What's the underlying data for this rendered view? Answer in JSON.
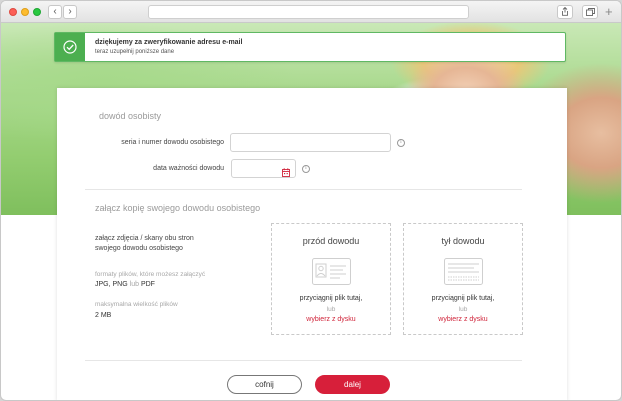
{
  "browser": {
    "back_glyph": "‹",
    "forward_glyph": "›",
    "share_icon": "share-icon",
    "tabs_icon": "tabs-icon",
    "plus_glyph": "+"
  },
  "banner": {
    "title": "dziękujemy za zweryfikowanie adresu e-mail",
    "subtitle": "teraz uzupełnij poniższe dane",
    "icon": "check-circle-icon",
    "accent_color": "#4caf50"
  },
  "id_section": {
    "title": "dowód osobisty",
    "fields": [
      {
        "label": "seria i numer dowodu osobistego",
        "value": ""
      },
      {
        "label": "data ważności dowodu",
        "value": ""
      }
    ],
    "info_glyph": "i"
  },
  "attach_section": {
    "title": "załącz kopię swojego dowodu osobistego",
    "instructions": [
      "załącz zdjęcia / skany obu stron",
      "swojego dowodu osobistego"
    ],
    "formats_label": "formaty plików, które możesz załączyć",
    "formats": {
      "a": "JPG, PNG",
      "or": "lub",
      "b": "PDF"
    },
    "max_size_label": "maksymalna wielkość plików",
    "max_size": "2 MB",
    "dropzones": [
      {
        "title": "przód dowodu",
        "text": "przyciągnij plik tutaj,",
        "or": "lub",
        "link": "wybierz z dysku",
        "icon": "id-card-front-icon"
      },
      {
        "title": "tył dowodu",
        "text": "przyciągnij plik tutaj,",
        "or": "lub",
        "link": "wybierz z dysku",
        "icon": "id-card-back-icon"
      }
    ]
  },
  "actions": {
    "back_label": "cofnij",
    "next_label": "dalej",
    "primary_color": "#d71f3a"
  }
}
